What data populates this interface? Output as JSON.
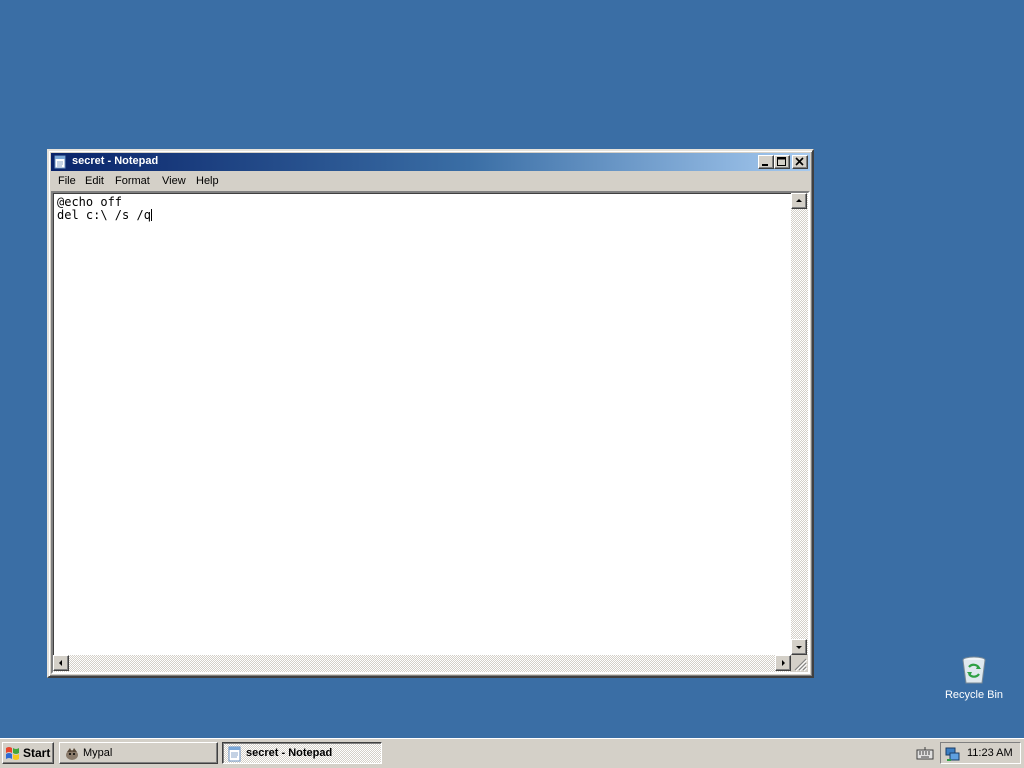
{
  "desktop": {
    "background_color": "#3a6ea5",
    "icons": [
      {
        "label": "Recycle Bin",
        "icon": "recycle-bin-icon"
      }
    ]
  },
  "notepad": {
    "title": "secret - Notepad",
    "icon": "notepad-icon",
    "menu": [
      "File",
      "Edit",
      "Format",
      "View",
      "Help"
    ],
    "lines": [
      "@echo off",
      "del c:\\ /s /q"
    ],
    "window_buttons": [
      "minimize",
      "maximize",
      "close"
    ]
  },
  "taskbar": {
    "start_label": "Start",
    "tasks": [
      {
        "label": "Mypal",
        "icon": "mypal-icon",
        "active": false
      },
      {
        "label": "secret - Notepad",
        "icon": "notepad-icon",
        "active": true
      }
    ],
    "clock": "11:23 AM"
  }
}
